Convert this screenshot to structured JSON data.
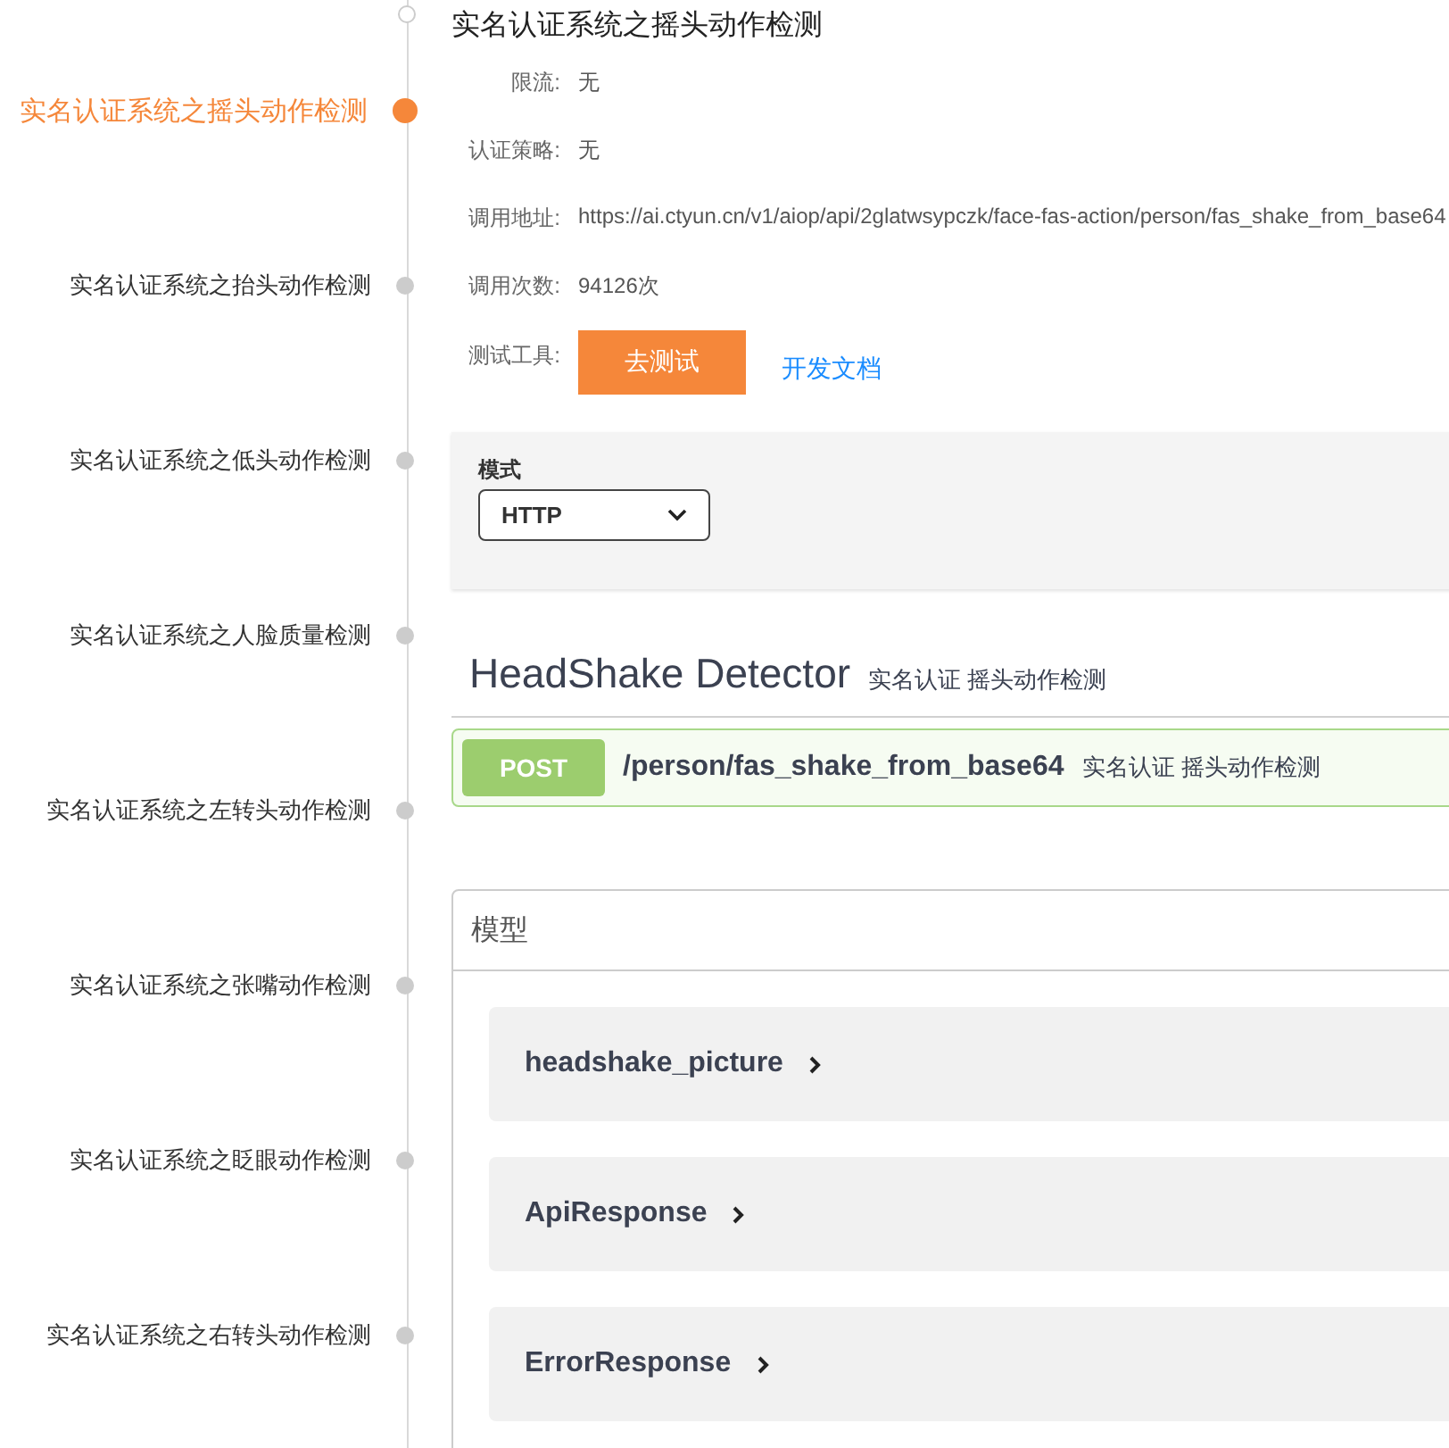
{
  "timeline": [
    {
      "label": "实名认证系统之摇头动作检测",
      "selected": true
    },
    {
      "label": "实名认证系统之抬头动作检测",
      "selected": false
    },
    {
      "label": "实名认证系统之低头动作检测",
      "selected": false
    },
    {
      "label": "实名认证系统之人脸质量检测",
      "selected": false
    },
    {
      "label": "实名认证系统之左转头动作检测",
      "selected": false
    },
    {
      "label": "实名认证系统之张嘴动作检测",
      "selected": false
    },
    {
      "label": "实名认证系统之眨眼动作检测",
      "selected": false
    },
    {
      "label": "实名认证系统之右转头动作检测",
      "selected": false
    }
  ],
  "title": "实名认证系统之摇头动作检测",
  "info": [
    {
      "label": "限流:",
      "value": "无"
    },
    {
      "label": "认证策略:",
      "value": "无"
    },
    {
      "label": "调用地址:",
      "value": "https://ai.ctyun.cn/v1/aiop/api/2glatwsypczk/face-fas-action/person/fas_shake_from_base64"
    },
    {
      "label": "调用次数:",
      "value": "94126次"
    }
  ],
  "tools": {
    "label": "测试工具:",
    "button": "去测试",
    "link": "开发文档"
  },
  "mode": {
    "label": "模式",
    "value": "HTTP"
  },
  "api": {
    "title": "HeadShake Detector",
    "subtitle": "实名认证 摇头动作检测"
  },
  "operation": {
    "method": "POST",
    "path": "/person/fas_shake_from_base64",
    "description": "实名认证 摇头动作检测"
  },
  "models": {
    "title": "模型",
    "items": [
      {
        "name": "headshake_picture",
        "expanded": false
      },
      {
        "name": "ApiResponse",
        "expanded": false
      },
      {
        "name": "ErrorResponse",
        "expanded": false
      }
    ]
  }
}
